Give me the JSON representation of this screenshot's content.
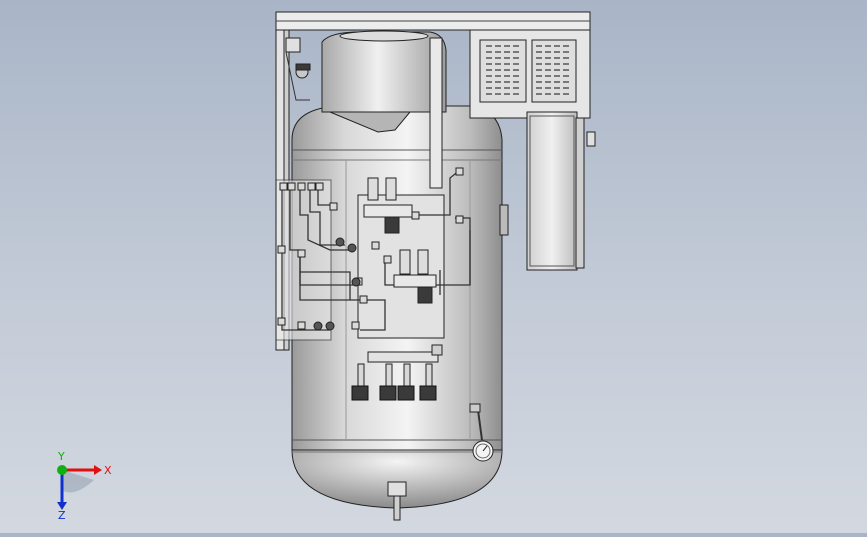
{
  "viewport": {
    "background_top": "#a9b5c7",
    "background_bottom": "#d3d8e0"
  },
  "model": {
    "metal_light": "#f2f2f2",
    "metal_mid": "#bdbdbd",
    "metal_dark": "#7a7a7a",
    "edge": "#222222",
    "valve_dark": "#3a3a3a"
  },
  "triad": {
    "x_label": "X",
    "y_label": "Y",
    "z_label": "Z",
    "x_color": "#e01010",
    "y_color": "#10b010",
    "z_color": "#1030d0"
  }
}
